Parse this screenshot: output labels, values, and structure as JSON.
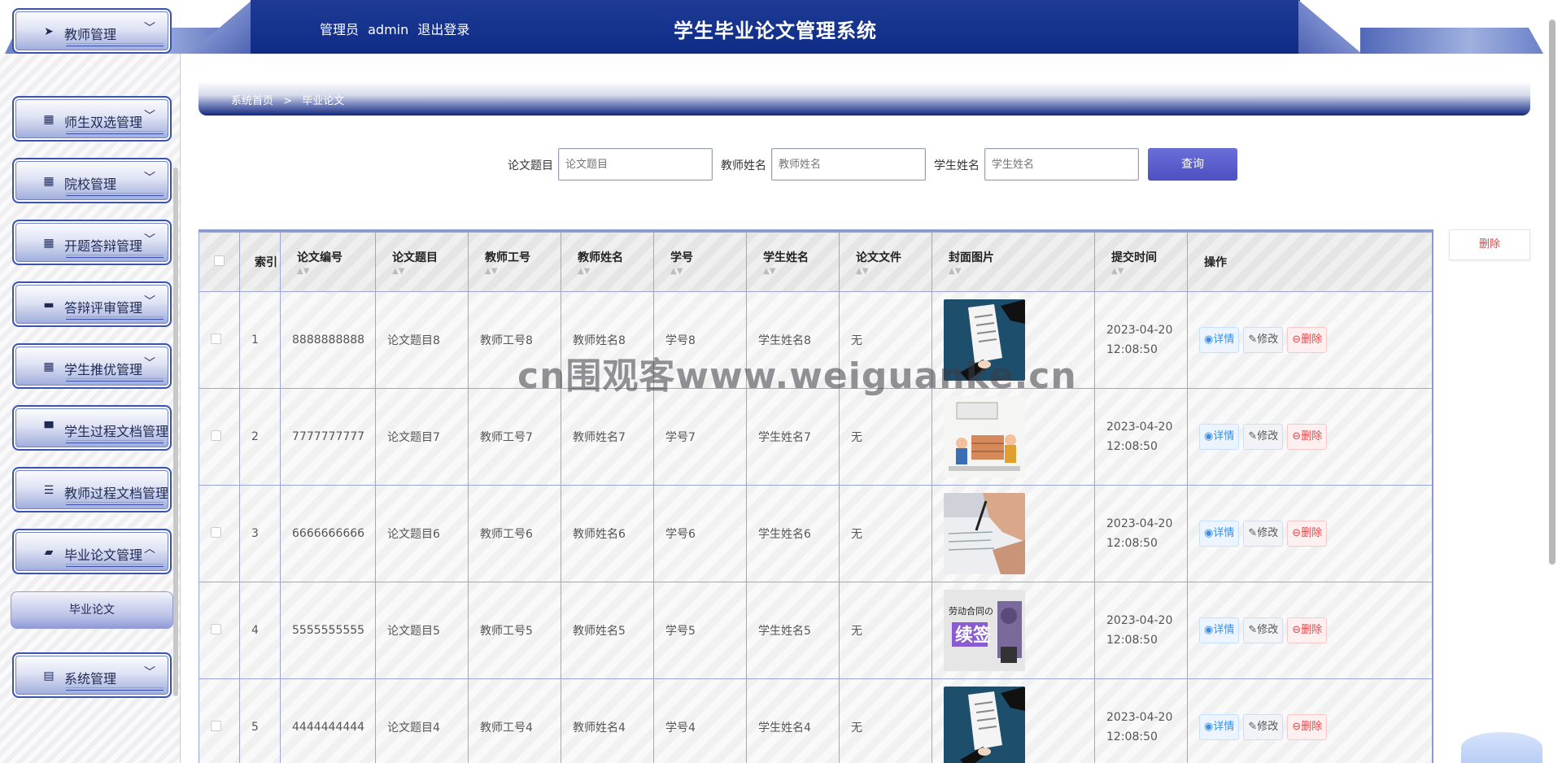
{
  "header": {
    "role": "管理员",
    "username": "admin",
    "logout": "退出登录",
    "title": "学生毕业论文管理系统"
  },
  "sidebar": {
    "items": [
      {
        "label": "教师管理",
        "icon": "send-icon",
        "chevron": "﹀"
      },
      {
        "label": "师生双选管理",
        "icon": "grid-icon",
        "chevron": "﹀"
      },
      {
        "label": "院校管理",
        "icon": "grid-icon",
        "chevron": "﹀"
      },
      {
        "label": "开题答辩管理",
        "icon": "grid-icon",
        "chevron": "﹀"
      },
      {
        "label": "答辩评审管理",
        "icon": "chat-icon",
        "chevron": "﹀"
      },
      {
        "label": "学生推优管理",
        "icon": "grid-icon",
        "chevron": "﹀"
      },
      {
        "label": "学生过程文档管理",
        "icon": "stamp-icon",
        "chevron": ""
      },
      {
        "label": "教师过程文档管理",
        "icon": "list-icon",
        "chevron": ""
      },
      {
        "label": "毕业论文管理",
        "icon": "wallet-icon",
        "chevron": "︿"
      },
      {
        "label": "系统管理",
        "icon": "ticket-icon",
        "chevron": "﹀"
      }
    ],
    "submenu": {
      "label": "毕业论文"
    }
  },
  "breadcrumb": {
    "home": "系统首页",
    "sep": ">",
    "current": "毕业论文"
  },
  "search": {
    "title_label": "论文题目",
    "title_placeholder": "论文题目",
    "teacher_label": "教师姓名",
    "teacher_placeholder": "教师姓名",
    "student_label": "学生姓名",
    "student_placeholder": "学生姓名",
    "button": "查询"
  },
  "actions": {
    "delete": "删除"
  },
  "table": {
    "headers": {
      "index": "索引",
      "no": "论文编号",
      "title": "论文题目",
      "teacher_id": "教师工号",
      "teacher_name": "教师姓名",
      "student_id": "学号",
      "student_name": "学生姓名",
      "file": "论文文件",
      "cover": "封面图片",
      "time": "提交时间",
      "ops": "操作"
    },
    "ops": {
      "detail": "详情",
      "edit": "修改",
      "delete": "删除"
    },
    "rows": [
      {
        "index": "1",
        "no": "8888888888",
        "title": "论文题目8",
        "teacher_id": "教师工号8",
        "teacher_name": "教师姓名8",
        "student_id": "学号8",
        "student_name": "学生姓名8",
        "file": "无",
        "date": "2023-04-20",
        "clock": "12:08:50",
        "cover": "contract-signing"
      },
      {
        "index": "2",
        "no": "7777777777",
        "title": "论文题目7",
        "teacher_id": "教师工号7",
        "teacher_name": "教师姓名7",
        "student_id": "学号7",
        "student_name": "学生姓名7",
        "file": "无",
        "date": "2023-04-20",
        "clock": "12:08:50",
        "cover": "cartoon-workers"
      },
      {
        "index": "3",
        "no": "6666666666",
        "title": "论文题目6",
        "teacher_id": "教师工号6",
        "teacher_name": "教师姓名6",
        "student_id": "学号6",
        "student_name": "学生姓名6",
        "file": "无",
        "date": "2023-04-20",
        "clock": "12:08:50",
        "cover": "hand-writing"
      },
      {
        "index": "4",
        "no": "5555555555",
        "title": "论文题目5",
        "teacher_id": "教师工号5",
        "teacher_name": "教师姓名5",
        "student_id": "学号5",
        "student_name": "学生姓名5",
        "file": "无",
        "date": "2023-04-20",
        "clock": "12:08:50",
        "cover": "contract-renewal",
        "cover_caption": "劳动合同の",
        "cover_big": "续签"
      },
      {
        "index": "5",
        "no": "4444444444",
        "title": "论文题目4",
        "teacher_id": "教师工号4",
        "teacher_name": "教师姓名4",
        "student_id": "学号4",
        "student_name": "学生姓名4",
        "file": "无",
        "date": "2023-04-20",
        "clock": "12:08:50",
        "cover": "contract-signing"
      }
    ]
  },
  "watermark": "cn围观客www.weiguanke.cn"
}
